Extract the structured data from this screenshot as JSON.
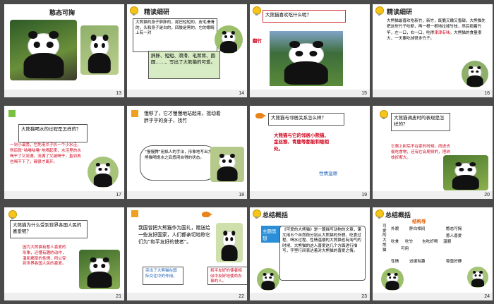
{
  "slides": {
    "s13": {
      "num": "13",
      "title": "憨态可掬"
    },
    "s14": {
      "num": "14",
      "title": "精读细研",
      "text": "大熊猫的身子胖胖的，尾巴短短的，皮毛滑滑的，头和身子是白的，四肢是黑的，它的眼睛上有一对",
      "green": "胖胖、短短、滑滑、毛茸茸、圆圆……，写出了大熊猫的可爱。"
    },
    "s15": {
      "num": "15",
      "title": "大熊猫喜欢吃什么呢？",
      "label": "翻竹"
    },
    "s16": {
      "num": "16",
      "title": "精读细研",
      "text": "大熊猫最喜欢吃新竹，新竹，既脆又嫩又香甜。大熊猫先把这些竹子咬断，再一根一根地拉掉竹枝，然后抱着竹竿，左一口，右一口，吃得",
      "red": "津津有味",
      "tail": "。大熊猫的食量很大，一天要吃掉很多竹子。"
    },
    "s17": {
      "num": "17",
      "title": "大熊猫喝水的过程是怎样的？",
      "red": "一到小溪旁，它先用爪子扒一个小水洼，然后就“咕噜咕噜”地喝起来，水洼里的水喝干了又流满，流满了又被喝干，直到再也喝不下了，都很才离开。"
    },
    "s18": {
      "num": "18",
      "text": "饿够了，它才慢慢地站起来，摇动着胖乎乎的身子，找竹",
      "bubble": "“慢慢腾”用拟人的手法，形象地写出大熊猫喝饱水之后悠闲自得的状态。"
    },
    "s19": {
      "num": "19",
      "title": "大熊猫与邻居关系怎么样？",
      "red": "大熊猫与它的邻居小熊猫、金丝猴、青鹿等都能和睦相处。",
      "blue": "性情温顺"
    },
    "s20": {
      "num": "20",
      "title": "大熊猫调皮时的表现是怎样的？",
      "red": "它爬上树后不在家的时候，闹进去偷吃食物，还有它会爬树的，把树枝折断大。"
    },
    "s21": {
      "num": "21",
      "title": "大熊猫为什么受到世界各国人民的喜爱呢？",
      "red": "因为大熊猫有惹人喜爱的形象，还懂有趣的动作，温和憨厚的性情，所以受到世界各国人民的喜爱。"
    },
    "s22": {
      "num": "22",
      "text": "我国曾把大熊猫作为国礼，赠送给一些友好国家，人们都亲切地称它们为“和平友好的使者”。",
      "left": "突出了大熊猫在国际交往中的作用。",
      "right": "和平友好的使者相似中友好地使命办事的人。"
    },
    "s23": {
      "num": "23",
      "title": "总结概括",
      "tag": "主题思想",
      "text": "《可爱的大熊猫》是一篇描写动物的文章，课文用五个自然段分别从大熊猫的外貌、吃食过程、喝水过程、性情温顺的大熊猫也有淘气的时候、大熊猫的这人喜爱这几个方面进行描写，字里行间表达着对大熊猫的喜爱之情。"
    },
    "s24": {
      "num": "24",
      "title": "总结概括",
      "struct": "结构导",
      "vert": "可爱的大熊猫",
      "r1a": "外貌",
      "r1b": "胖白相间",
      "r1c": "憨态可掬",
      "r2a": "吃食",
      "r2b": "吃竹",
      "r2c": "吉吃好喝",
      "r3a": "温顺",
      "r3b": "可用",
      "r4a": "性情",
      "r4b": "迟缓有趣",
      "r4c": "惹人喜爱",
      "r5": "稳重好静"
    }
  }
}
